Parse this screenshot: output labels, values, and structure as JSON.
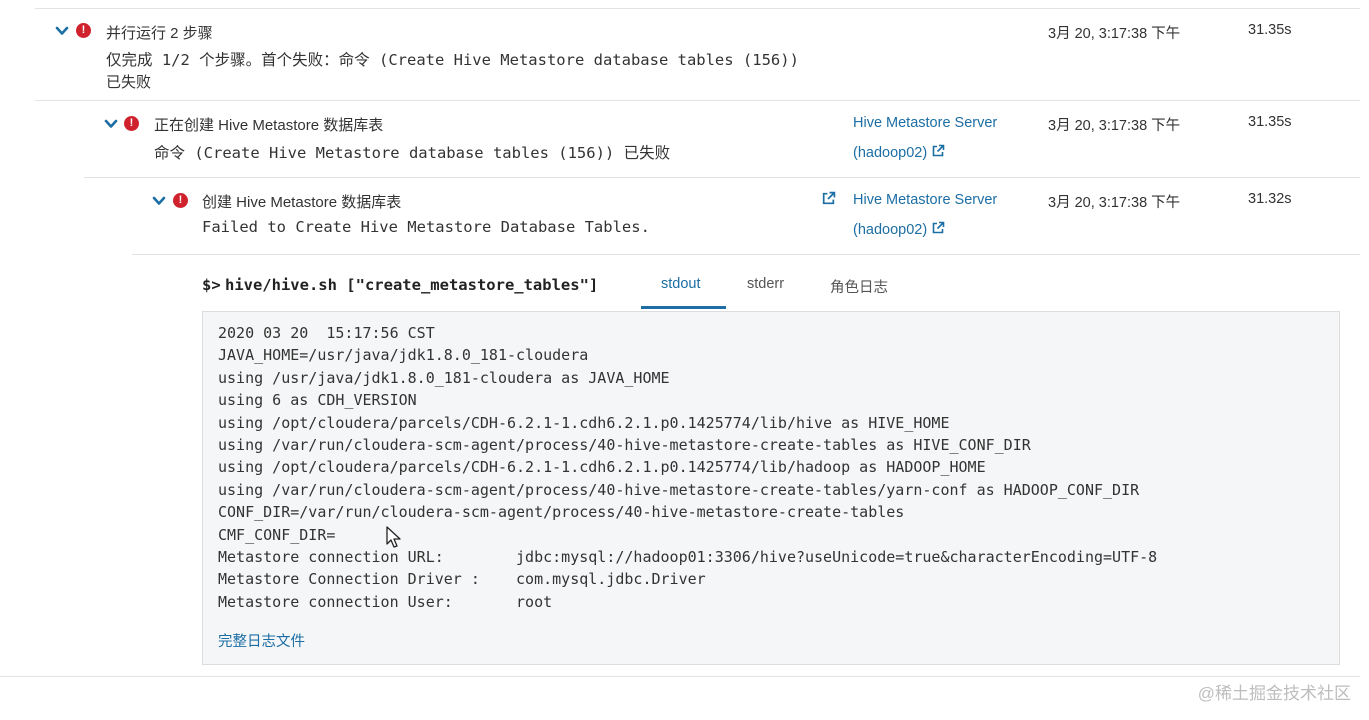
{
  "steps": [
    {
      "title": "并行运行 2 步骤",
      "message_line1": "仅完成 1/2 个步骤。首个失败：命令 (Create Hive Metastore database tables (156))",
      "message_line2": "已失败",
      "role": "",
      "host": "",
      "time": "3月 20, 3:17:38 下午",
      "duration": "31.35s"
    },
    {
      "title": "正在创建 Hive Metastore 数据库表",
      "message_line1": "命令 (Create Hive Metastore database tables (156)) 已失败",
      "role": "Hive Metastore Server",
      "host": "(hadoop02)",
      "time": "3月 20, 3:17:38 下午",
      "duration": "31.35s"
    },
    {
      "title": "创建 Hive Metastore 数据库表",
      "message_line1": "Failed to Create Hive Metastore Database Tables.",
      "role": "Hive Metastore Server",
      "host": "(hadoop02)",
      "time": "3月 20, 3:17:38 下午",
      "duration": "31.32s"
    }
  ],
  "command": {
    "prompt": "$>",
    "text": "hive/hive.sh [\"create_metastore_tables\"]"
  },
  "tabs": [
    {
      "label": "stdout",
      "active": true
    },
    {
      "label": "stderr",
      "active": false
    },
    {
      "label": "角色日志",
      "active": false
    }
  ],
  "log_lines": [
    "2020 03 20  15:17:56 CST",
    "JAVA_HOME=/usr/java/jdk1.8.0_181-cloudera",
    "using /usr/java/jdk1.8.0_181-cloudera as JAVA_HOME",
    "using 6 as CDH_VERSION",
    "using /opt/cloudera/parcels/CDH-6.2.1-1.cdh6.2.1.p0.1425774/lib/hive as HIVE_HOME",
    "using /var/run/cloudera-scm-agent/process/40-hive-metastore-create-tables as HIVE_CONF_DIR",
    "using /opt/cloudera/parcels/CDH-6.2.1-1.cdh6.2.1.p0.1425774/lib/hadoop as HADOOP_HOME",
    "using /var/run/cloudera-scm-agent/process/40-hive-metastore-create-tables/yarn-conf as HADOOP_CONF_DIR",
    "CONF_DIR=/var/run/cloudera-scm-agent/process/40-hive-metastore-create-tables",
    "CMF_CONF_DIR=",
    "Metastore connection URL:        jdbc:mysql://hadoop01:3306/hive?useUnicode=true&characterEncoding=UTF-8",
    "Metastore Connection Driver :    com.mysql.jdbc.Driver",
    "Metastore connection User:       root"
  ],
  "full_log_link": "完整日志文件",
  "watermark": "@稀土掘金技术社区",
  "colors": {
    "link": "#1c6ea4",
    "error": "#d0222c",
    "log_background": "#f5f6f7"
  },
  "icons": {
    "expand": "chevron-down-icon",
    "status": "error-icon",
    "external": "external-link-icon"
  }
}
